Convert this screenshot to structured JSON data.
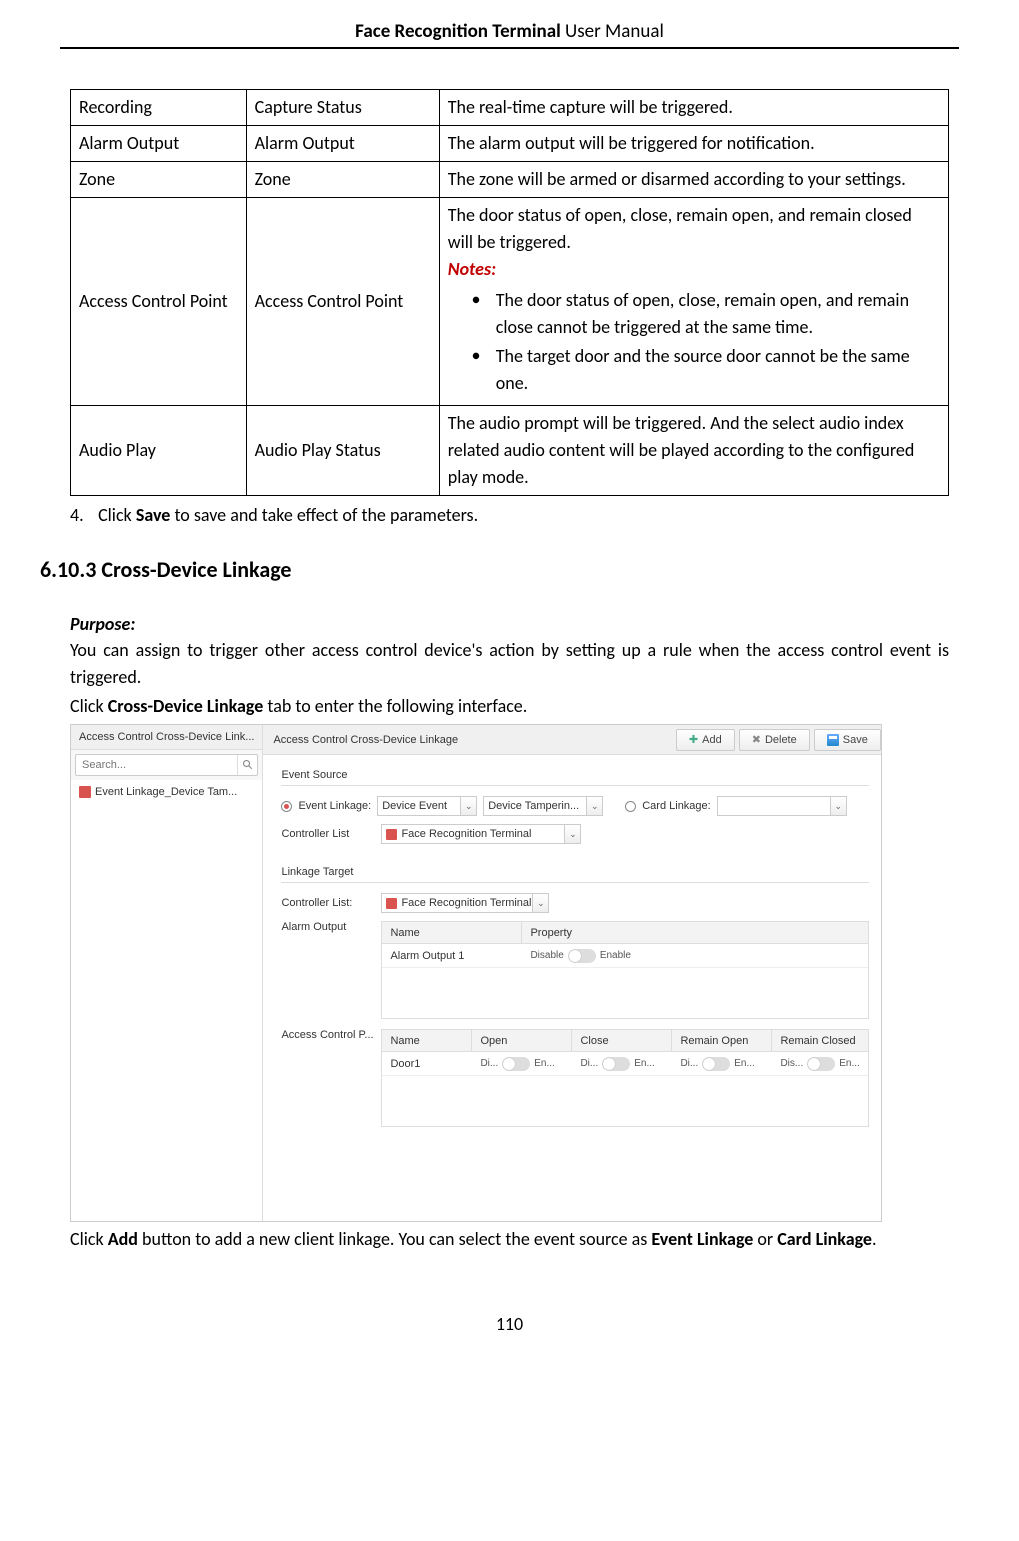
{
  "header": {
    "bold": "Face Recognition Terminal",
    "rest": "  User Manual"
  },
  "table": {
    "rows": [
      {
        "c1": "Recording",
        "c2": "Capture Status",
        "c3_plain": "The real-time capture will be triggered."
      },
      {
        "c1": "Alarm Output",
        "c2": "Alarm Output",
        "c3_plain": "The alarm output will be triggered for notification."
      },
      {
        "c1": "Zone",
        "c2": "Zone",
        "c3_plain": "The zone will be armed or disarmed according to your settings."
      },
      {
        "c1": "Access Control Point",
        "c2": "Access Control Point",
        "c3_complex": {
          "intro": "The door status of open, close, remain open, and remain closed will be triggered.",
          "notes_label": "Notes:",
          "bullets": [
            "The door status of open, close, remain open, and remain close cannot be triggered at the same time.",
            "The target door and the source door cannot be the same one."
          ]
        }
      },
      {
        "c1": "Audio Play",
        "c2": "Audio Play Status",
        "c3_plain": "The audio prompt will be triggered. And the select audio index related audio content will be played according to the configured play mode."
      }
    ]
  },
  "step4": {
    "num": "4.",
    "pre": "Click ",
    "bold": "Save",
    "post": " to save and take effect of the parameters."
  },
  "section_heading": "6.10.3 Cross-Device Linkage",
  "purpose_label": "Purpose:",
  "purpose_text": "You can assign to trigger other access control device's action by setting up a rule when the access control event is triggered.",
  "click_tab": {
    "pre": "Click ",
    "bold": "Cross-Device Linkage",
    "post": " tab to enter the following interface."
  },
  "screenshot": {
    "left": {
      "title": "Access Control Cross-Device Link...",
      "search_placeholder": "Search...",
      "tree_item": "Event Linkage_Device Tam..."
    },
    "toolbar": {
      "title": "Access Control Cross-Device Linkage",
      "add": "Add",
      "delete": "Delete",
      "save": "Save"
    },
    "event_source": {
      "legend": "Event Source",
      "event_linkage_label": "Event Linkage:",
      "event_type": "Device Event",
      "event_detail": "Device Tamperin...",
      "card_linkage_label": "Card Linkage:",
      "controller_list_label": "Controller List",
      "controller_value": "Face Recognition Terminal"
    },
    "linkage_target": {
      "legend": "Linkage Target",
      "controller_list_label": "Controller List:",
      "controller_value": "Face Recognition Terminal",
      "alarm_output_label": "Alarm Output",
      "alarm_table": {
        "headers": [
          "Name",
          "Property"
        ],
        "row": {
          "name": "Alarm Output 1",
          "left": "Disable",
          "right": "Enable"
        }
      },
      "acp_label": "Access Control P...",
      "acp_table": {
        "headers": [
          "Name",
          "Open",
          "Close",
          "Remain Open",
          "Remain Closed"
        ],
        "row": {
          "name": "Door1",
          "cells": [
            {
              "l": "Di...",
              "r": "En..."
            },
            {
              "l": "Di...",
              "r": "En..."
            },
            {
              "l": "Di...",
              "r": "En..."
            },
            {
              "l": "Dis...",
              "r": "En..."
            }
          ]
        }
      }
    }
  },
  "after_text": {
    "pre": "Click ",
    "b1": "Add",
    "mid1": " button to add a new client linkage. You can select the event source as ",
    "b2": "Event Linkage",
    "mid2": " or ",
    "b3": "Card Linkage",
    "post": "."
  },
  "page_number": "110"
}
